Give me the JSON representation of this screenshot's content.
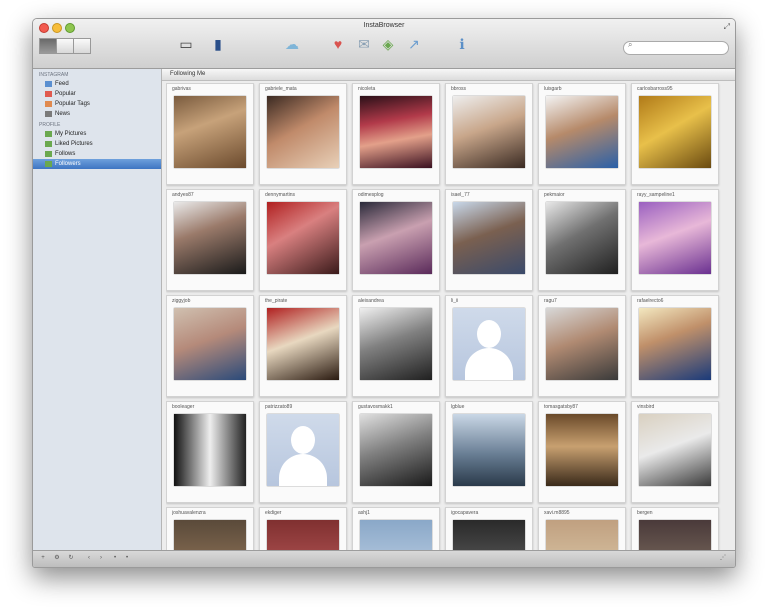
{
  "window": {
    "title": "InstaBrowser"
  },
  "toolbar": {
    "buttons": [
      {
        "icon": "monitor-icon",
        "glyph": "▭",
        "label": "",
        "color": "#444444"
      },
      {
        "icon": "book-icon",
        "glyph": "▮",
        "label": "",
        "color": "#2a4f8a"
      },
      {
        "icon": "cloud-icon",
        "glyph": "☁",
        "label": "",
        "color": "#7fb5d8"
      },
      {
        "icon": "heart-icon",
        "glyph": "♥",
        "label": "",
        "color": "#d9534f"
      },
      {
        "icon": "comment-icon",
        "glyph": "✉",
        "label": "",
        "color": "#8aa0b4"
      },
      {
        "icon": "tag-icon",
        "glyph": "◈",
        "label": "",
        "color": "#6aa84f"
      },
      {
        "icon": "share-icon",
        "glyph": "↗",
        "label": "",
        "color": "#6d9ecf"
      },
      {
        "icon": "info-icon",
        "glyph": "ℹ",
        "label": "",
        "color": "#5b8fc7"
      }
    ],
    "search_placeholder": ""
  },
  "sidebar": {
    "sections": [
      {
        "title": "Instagram",
        "items": [
          {
            "label": "Feed",
            "icon": "feed-icon",
            "color": "#5a8fd0",
            "badge": "",
            "selected": false
          },
          {
            "label": "Popular",
            "icon": "popular-icon",
            "color": "#e05a4f",
            "badge": "",
            "selected": false
          },
          {
            "label": "Popular Tags",
            "icon": "tag-icon",
            "color": "#e08a4f",
            "badge": "",
            "selected": false
          },
          {
            "label": "News",
            "icon": "news-icon",
            "color": "#7a7a7a",
            "badge": "",
            "selected": false
          }
        ]
      },
      {
        "title": "Profile",
        "items": [
          {
            "label": "My Pictures",
            "icon": "pictures-icon",
            "color": "#6aa84f",
            "badge": "",
            "selected": false
          },
          {
            "label": "Liked Pictures",
            "icon": "liked-icon",
            "color": "#6aa84f",
            "badge": "",
            "selected": false
          },
          {
            "label": "Follows",
            "icon": "follows-icon",
            "color": "#6aa84f",
            "badge": "",
            "selected": false
          },
          {
            "label": "Followers",
            "icon": "followers-icon",
            "color": "#6aa84f",
            "badge": "",
            "selected": true
          }
        ]
      }
    ]
  },
  "main": {
    "header": "Following Me",
    "cards": [
      {
        "username": "gabrivas",
        "photo": "linear-gradient(160deg,#7a5b3e,#c7a27a 40%,#6b4a2d)"
      },
      {
        "username": "gabriele_mata",
        "photo": "linear-gradient(150deg,#3b2a22,#c08a6a 45%,#e8d0b8)"
      },
      {
        "username": "nicoleta",
        "photo": "linear-gradient(170deg,#2a1018,#b23a4a 35%,#e3a08a 60%,#3a1020)"
      },
      {
        "username": "bbross",
        "photo": "linear-gradient(160deg,#eeeeee,#c8a68a 45%,#3a2a22)"
      },
      {
        "username": "luisgarb",
        "photo": "linear-gradient(160deg,#f3f3f3,#b68a6a 45%,#2a60a8)"
      },
      {
        "username": "carlosbarross95",
        "photo": "linear-gradient(150deg,#b07a18,#e8c04a 45%,#6a4a10)"
      },
      {
        "username": "andyes87",
        "photo": "linear-gradient(160deg,#eaeaea,#9a7a6a 40%,#1a1a1a)"
      },
      {
        "username": "dennymartins",
        "photo": "linear-gradient(150deg,#b02020,#d98080 40%,#3a1a1a)"
      },
      {
        "username": "odimesplog",
        "photo": "linear-gradient(160deg,#2a2a3a,#c9a0b0 45%,#5a2a5a)"
      },
      {
        "username": "isael_77",
        "photo": "linear-gradient(160deg,#c8d8ea,#7a6050 45%,#3a4a6a)"
      },
      {
        "username": "pekmaior",
        "photo": "linear-gradient(150deg,#e8e8e8,#707070 45%,#202020)"
      },
      {
        "username": "rayy_sampeline1",
        "photo": "linear-gradient(160deg,#9a60c0,#e8b8d8 45%,#6a3090)"
      },
      {
        "username": "ziggyjob",
        "photo": "linear-gradient(160deg,#d0c0b0,#b58a7a 45%,#2a4a7a)"
      },
      {
        "username": "the_pirate",
        "photo": "linear-gradient(160deg,#b02020,#e8d8c0 45%,#2a1a10)"
      },
      {
        "username": "aleixandrea",
        "photo": "linear-gradient(160deg,#f0f0f0,#808080 45%,#202020)"
      },
      {
        "username": "li_ii",
        "photo": "linear-gradient(#cfdaea,#b7c6de)",
        "silhouette": true
      },
      {
        "username": "ragu7",
        "photo": "linear-gradient(160deg,#d8d8d8,#b08a72 45%,#3a3a3a)"
      },
      {
        "username": "rafaelrecto6",
        "photo": "linear-gradient(160deg,#f3e8c0,#c0906a 40%,#1a3a7a)"
      },
      {
        "username": "booleager",
        "photo": "linear-gradient(90deg,#111111,#eeeeee 50%,#222222)"
      },
      {
        "username": "patrizzato89",
        "photo": "linear-gradient(#cfdaea,#b7c6de)",
        "silhouette": true
      },
      {
        "username": "gustavosmakk1",
        "photo": "linear-gradient(160deg,#e0e0e0,#808080 45%,#1a1a1a)"
      },
      {
        "username": "lgblue",
        "photo": "linear-gradient(180deg,#c9d7e6,#6a7f95 55%,#2a3a4a)"
      },
      {
        "username": "tomasgatsby87",
        "photo": "linear-gradient(180deg,#6a4a2a,#c8a070 45%,#3a2a1a)"
      },
      {
        "username": "vinsbird",
        "photo": "linear-gradient(160deg,#d9d0c0,#eaeaea 45%,#3a3a3a)"
      },
      {
        "username": "joshuavalenzra",
        "photo": "linear-gradient(#5a4a3a,#a08060)"
      },
      {
        "username": "ekdiger",
        "photo": "linear-gradient(#803030,#c06060)"
      },
      {
        "username": "ashj1",
        "photo": "linear-gradient(#8aa8c8,#c8d8ea)"
      },
      {
        "username": "igocapavera",
        "photo": "linear-gradient(#2a2a2a,#6a6a6a)"
      },
      {
        "username": "xavi.m8895",
        "photo": "linear-gradient(#c0a080,#e0d0b0)"
      },
      {
        "username": "bergen",
        "photo": "linear-gradient(#4a3a3a,#8a7a6a)"
      }
    ]
  }
}
